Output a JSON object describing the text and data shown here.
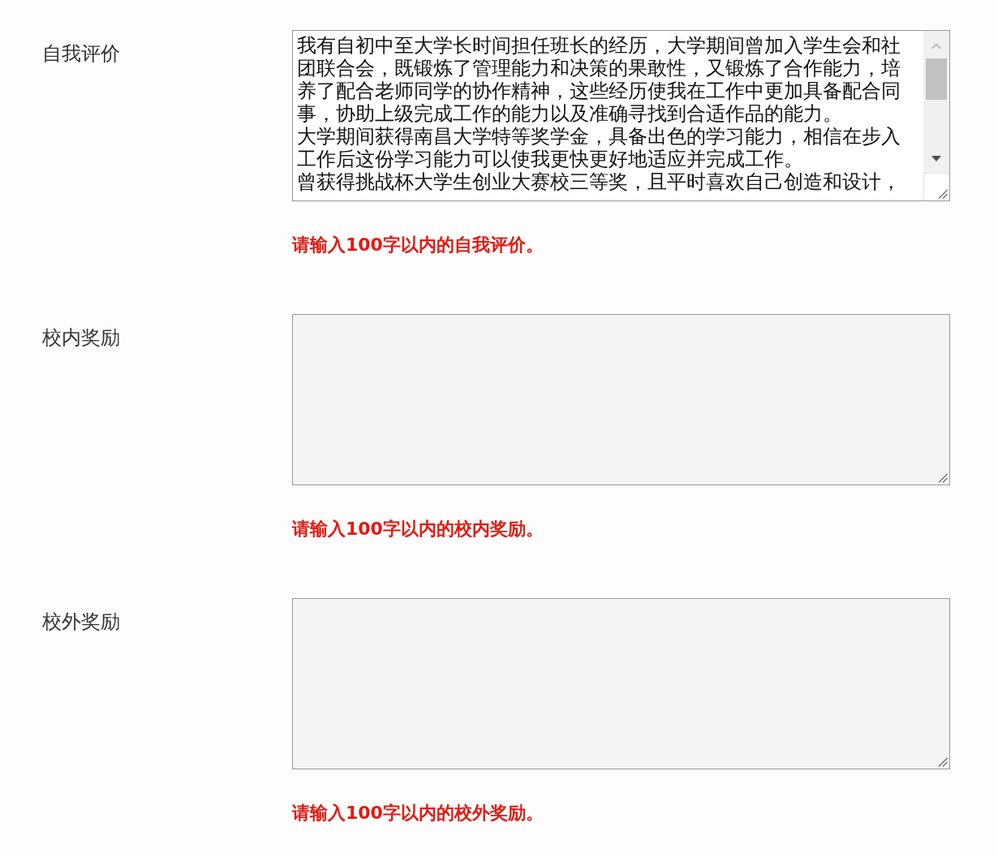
{
  "fields": [
    {
      "label": "自我评价",
      "paragraphs": [
        "我有自初中至大学长时间担任班长的经历，大学期间曾加入学生会和社团联合会，既锻炼了管理能力和决策的果敢性，又锻炼了合作能力，培养了配合老师同学的协作精神，这些经历使我在工作中更加具备配合同事，协助上级完成工作的能力以及准确寻找到合适作品的能力。",
        "大学期间获得南昌大学特等奖学金，具备出色的学习能力，相信在步入工作后这份学习能力可以使我更快更好地适应并完成工作。",
        "曾获得挑战杯大学生创业大赛校三等奖，且平时喜欢自己创造和设计，"
      ],
      "scrollbar": true,
      "error": "请输入100字以内的自我评价。"
    },
    {
      "label": "校内奖励",
      "scrollbar": false,
      "error": "请输入100字以内的校内奖励。"
    },
    {
      "label": "校外奖励",
      "scrollbar": false,
      "error": "请输入100字以内的校外奖励。"
    }
  ]
}
